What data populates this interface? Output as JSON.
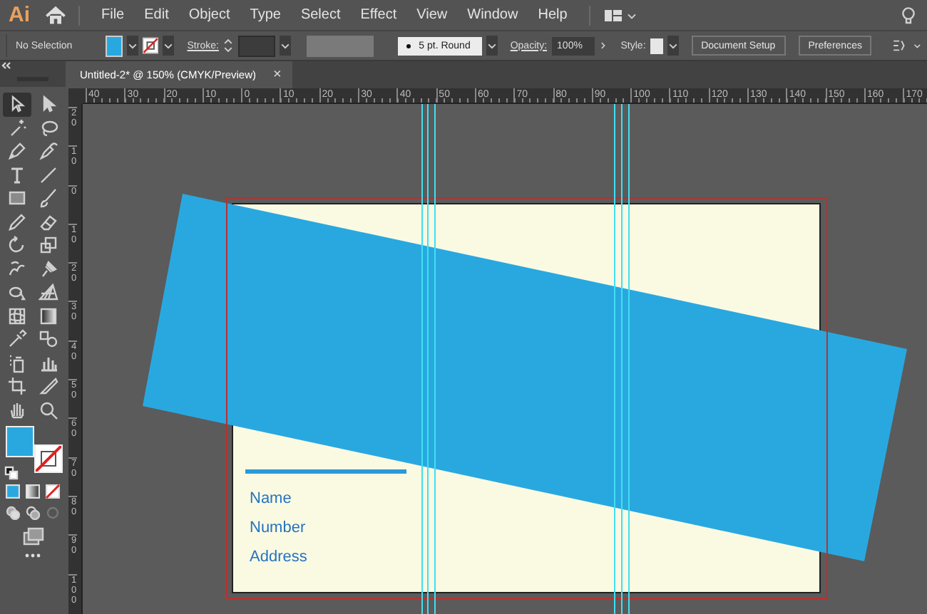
{
  "menubar": {
    "logo": "Ai",
    "menu": [
      "File",
      "Edit",
      "Object",
      "Type",
      "Select",
      "Effect",
      "View",
      "Window",
      "Help"
    ]
  },
  "control_bar": {
    "selection": "No Selection",
    "stroke_label": "Stroke:",
    "brush": "5 pt. Round",
    "opacity_label": "Opacity:",
    "opacity": "100%",
    "style_label": "Style:",
    "buttons": [
      "Document Setup",
      "Preferences"
    ]
  },
  "tabs": [
    {
      "label": "Untitled-2* @ 150% (CMYK/Preview)",
      "selected": true,
      "close": "×"
    }
  ],
  "rulers": {
    "horizontal": [
      "40",
      "30",
      "20",
      "10",
      "0",
      "10",
      "20",
      "30",
      "40",
      "50",
      "60",
      "70",
      "80",
      "90",
      "100",
      "110",
      "120",
      "130",
      "140",
      "150",
      "160",
      "170"
    ],
    "vertical": [
      "20",
      "10",
      "0",
      "10",
      "20",
      "30",
      "40",
      "50",
      "60",
      "70",
      "80",
      "90",
      "100"
    ]
  },
  "artboard": {
    "labels": [
      "Name",
      "Number",
      "Address"
    ]
  }
}
